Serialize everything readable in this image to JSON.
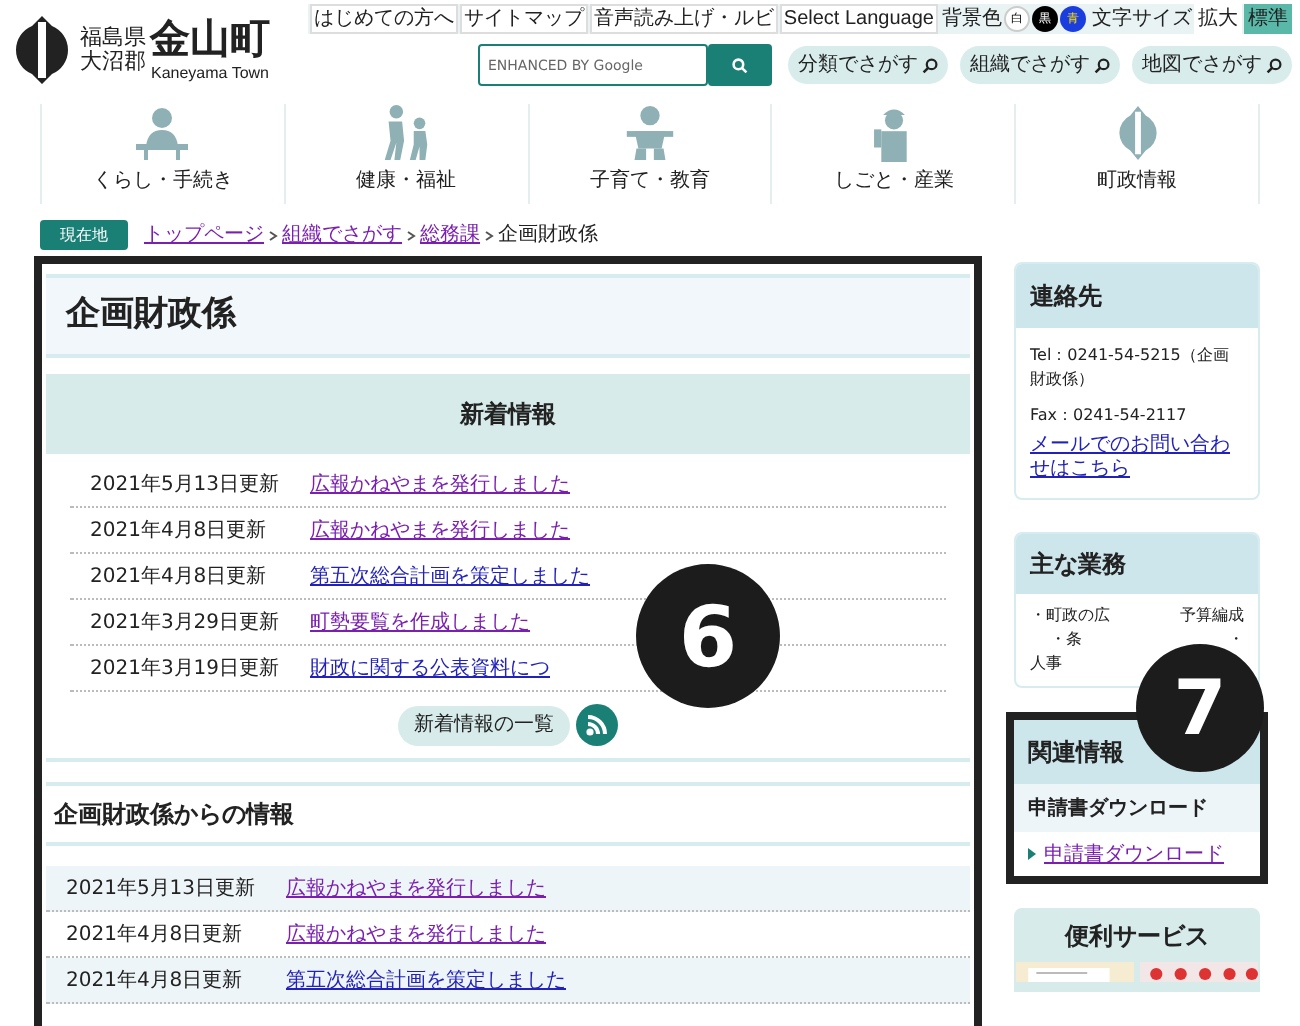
{
  "header": {
    "logo_prefecture": "福島県",
    "logo_district": "大沼郡",
    "logo_name": "金山町",
    "logo_english": "Kaneyama Town",
    "top_links": [
      "はじめての方へ",
      "サイトマップ",
      "音声読み上げ・ルビ",
      "Select Language"
    ],
    "bg_color": {
      "label": "背景色",
      "options": [
        {
          "label": "白",
          "kind": "white"
        },
        {
          "label": "黒",
          "kind": "black"
        },
        {
          "label": "青",
          "kind": "blue"
        }
      ]
    },
    "font_size": {
      "label": "文字サイズ",
      "options": [
        {
          "label": "拡大",
          "selected": false
        },
        {
          "label": "標準",
          "selected": true
        }
      ]
    },
    "search": {
      "placeholder": "ENHANCED BY Google"
    },
    "find_buttons": [
      "分類でさがす",
      "組織でさがす",
      "地図でさがす"
    ]
  },
  "nav": [
    {
      "label": "くらし・手続き",
      "kind": "desk"
    },
    {
      "label": "健康・福祉",
      "kind": "people"
    },
    {
      "label": "子育て・教育",
      "kind": "baby"
    },
    {
      "label": "しごと・産業",
      "kind": "worker"
    },
    {
      "label": "町政情報",
      "kind": "emblem"
    }
  ],
  "breadcrumb": {
    "label": "現在地",
    "links": [
      "トップページ",
      "組織でさがす",
      "総務課"
    ],
    "current": "企画財政係"
  },
  "main": {
    "title": "企画財政係",
    "news": {
      "heading": "新着情報",
      "rows": [
        {
          "date": "2021年5月13日更新",
          "title": "広報かねやまを発行しました",
          "visited": true
        },
        {
          "date": "2021年4月8日更新",
          "title": "広報かねやまを発行しました",
          "visited": true
        },
        {
          "date": "2021年4月8日更新",
          "title": "第五次総合計画を策定しました",
          "visited": false
        },
        {
          "date": "2021年3月29日更新",
          "title": "町勢要覧を作成しました",
          "visited": true
        },
        {
          "date": "2021年3月19日更新",
          "title": "財政に関する公表資料につ",
          "visited": false
        }
      ],
      "list_button": "新着情報の一覧"
    },
    "info": {
      "heading": "企画財政係からの情報",
      "rows": [
        {
          "date": "2021年5月13日更新",
          "title": "広報かねやまを発行しました",
          "visited": true
        },
        {
          "date": "2021年4月8日更新",
          "title": "広報かねやまを発行しました",
          "visited": true
        },
        {
          "date": "2021年4月8日更新",
          "title": "第五次総合計画を策定しました",
          "visited": false
        }
      ]
    }
  },
  "sidebar": {
    "contact": {
      "heading": "連絡先",
      "tel": "Tel：0241-54-5215（企画財政係）",
      "fax": "Fax：0241-54-2117",
      "mail_link": "メールでのお問い合わせはこちら"
    },
    "duties": {
      "heading": "主な業務",
      "line_1": "・町政の広",
      "line_1b": "予算編成",
      "line_2": "・条",
      "line_2b": "・",
      "line_3": "人事"
    },
    "related": {
      "heading": "関連情報",
      "subheading": "申請書ダウンロード",
      "link": "申請書ダウンロード"
    },
    "services": {
      "heading": "便利サービス"
    }
  },
  "callouts": [
    "6",
    "7"
  ]
}
